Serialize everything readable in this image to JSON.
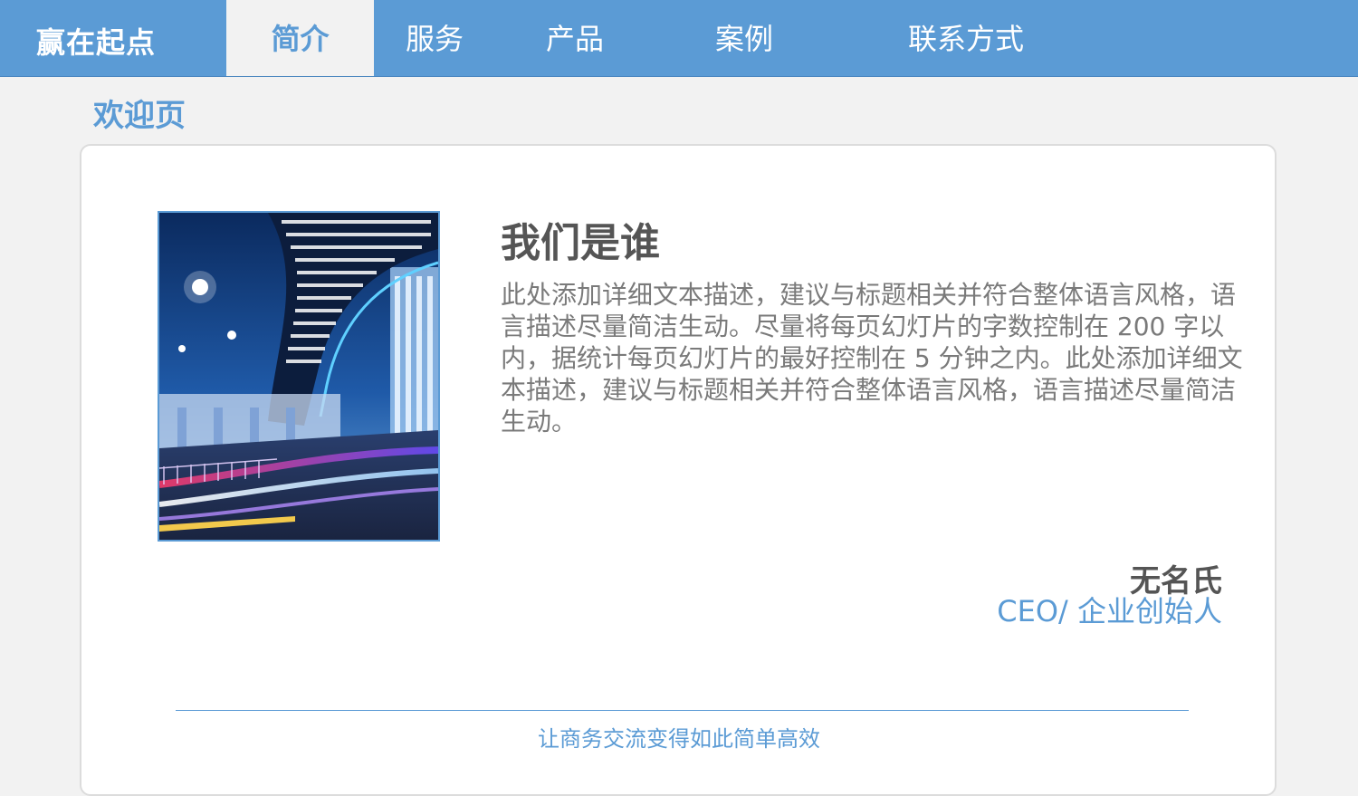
{
  "header": {
    "brand": "赢在起点",
    "nav": [
      {
        "label": "简介",
        "active": true
      },
      {
        "label": "服务",
        "active": false
      },
      {
        "label": "产品",
        "active": false
      },
      {
        "label": "案例",
        "active": false
      },
      {
        "label": "联系方式",
        "active": false
      }
    ]
  },
  "page": {
    "title": "欢迎页"
  },
  "content": {
    "headline": "我们是谁",
    "description": "此处添加详细文本描述，建议与标题相关并符合整体语言风格，语言描述尽量简洁生动。尽量将每页幻灯片的字数控制在 200 字以内，据统计每页幻灯片的最好控制在 5 分钟之内。此处添加详细文本描述，建议与标题相关并符合整体语言风格，语言描述尽量简洁生动。",
    "person_name": "无名氏",
    "person_role": "CEO/ 企业创始人"
  },
  "footer": {
    "slogan": "让商务交流变得如此简单高效"
  },
  "colors": {
    "accent": "#5b9bd5",
    "background": "#f2f2f2",
    "text_dark": "#555555",
    "text_muted": "#7a7a7a"
  },
  "icons": {
    "photo": "city-overpass-light-trails-photo"
  }
}
